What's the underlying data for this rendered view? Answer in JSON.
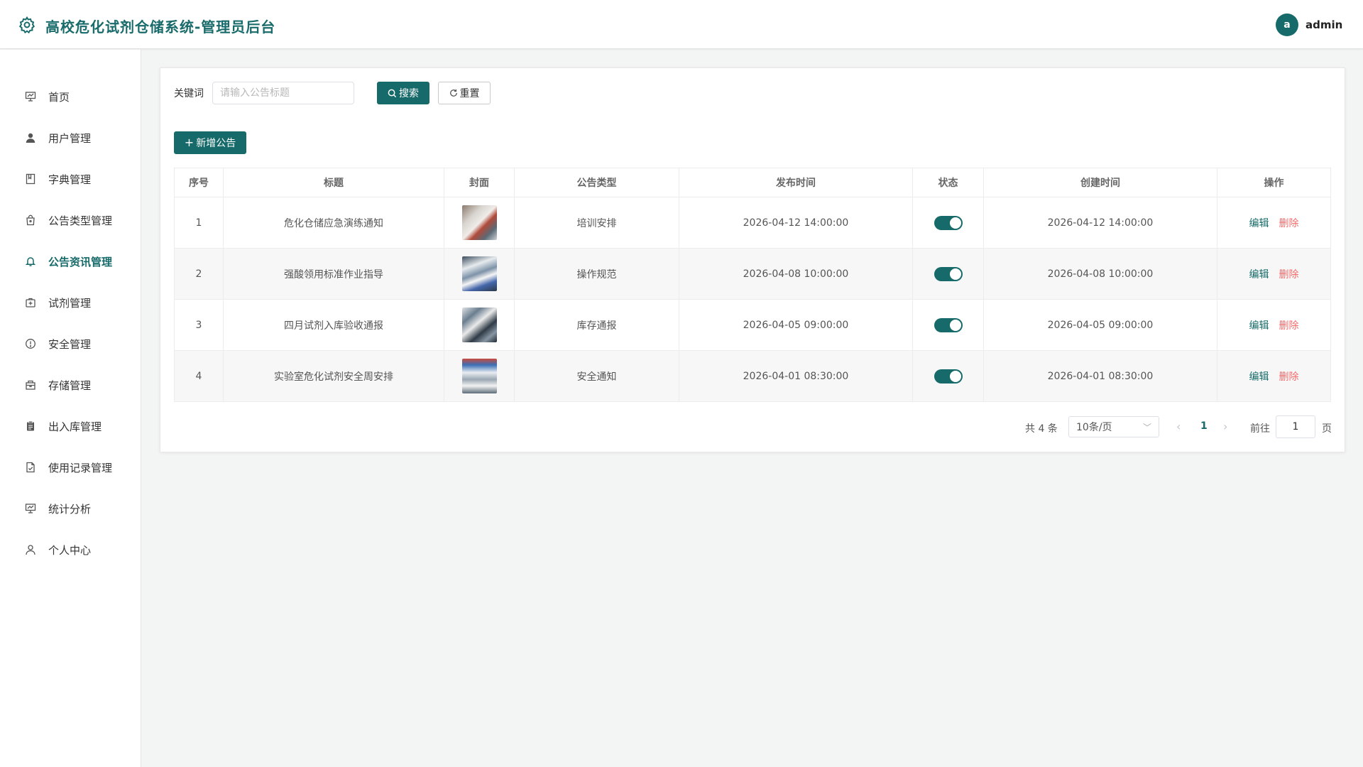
{
  "app": {
    "title": "高校危化试剂仓储系统-管理员后台",
    "logo_icon": "gear-icon"
  },
  "user": {
    "avatar_letter": "a",
    "name": "admin"
  },
  "sidebar": {
    "items": [
      {
        "label": "首页",
        "icon": "presentation-icon"
      },
      {
        "label": "用户管理",
        "icon": "user-icon"
      },
      {
        "label": "字典管理",
        "icon": "book-icon"
      },
      {
        "label": "公告类型管理",
        "icon": "shopping-bag-icon"
      },
      {
        "label": "公告资讯管理",
        "icon": "bell-icon",
        "active": true
      },
      {
        "label": "试剂管理",
        "icon": "medicine-box-icon"
      },
      {
        "label": "安全管理",
        "icon": "warning-icon"
      },
      {
        "label": "存储管理",
        "icon": "box-icon"
      },
      {
        "label": "出入库管理",
        "icon": "clipboard-icon"
      },
      {
        "label": "使用记录管理",
        "icon": "document-check-icon"
      },
      {
        "label": "统计分析",
        "icon": "chart-board-icon"
      },
      {
        "label": "个人中心",
        "icon": "person-icon"
      }
    ]
  },
  "search": {
    "label": "关键词",
    "placeholder": "请输入公告标题",
    "value": "",
    "search_label": "搜索",
    "reset_label": "重置"
  },
  "toolbar": {
    "add_label": "新增公告"
  },
  "table": {
    "columns": [
      "序号",
      "标题",
      "封面",
      "公告类型",
      "发布时间",
      "状态",
      "创建时间",
      "操作"
    ],
    "rows": [
      {
        "index": "1",
        "title": "危化仓储应急演练通知",
        "type": "培训安排",
        "publish_time": "2026-04-12 14:00:00",
        "status": true,
        "created_time": "2026-04-12 14:00:00"
      },
      {
        "index": "2",
        "title": "强酸领用标准作业指导",
        "type": "操作规范",
        "publish_time": "2026-04-08 10:00:00",
        "status": true,
        "created_time": "2026-04-08 10:00:00"
      },
      {
        "index": "3",
        "title": "四月试剂入库验收通报",
        "type": "库存通报",
        "publish_time": "2026-04-05 09:00:00",
        "status": true,
        "created_time": "2026-04-05 09:00:00"
      },
      {
        "index": "4",
        "title": "实验室危化试剂安全周安排",
        "type": "安全通知",
        "publish_time": "2026-04-01 08:30:00",
        "status": true,
        "created_time": "2026-04-01 08:30:00"
      }
    ],
    "edit_label": "编辑",
    "delete_label": "删除"
  },
  "pagination": {
    "total_text": "共 4 条",
    "page_size": "10条/页",
    "current_page": "1",
    "goto_label": "前往",
    "goto_value": "1",
    "page_suffix": "页"
  },
  "colors": {
    "primary": "#176a6a",
    "danger": "#f36b6b"
  }
}
